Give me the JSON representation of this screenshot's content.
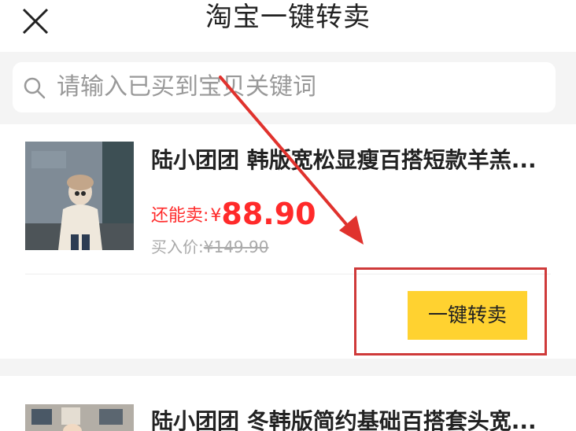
{
  "header": {
    "title": "淘宝一键转卖",
    "close_icon": "close-icon"
  },
  "search": {
    "placeholder": "请输入已买到宝贝关键词",
    "icon": "search-icon"
  },
  "items": [
    {
      "title": "陆小团团 韩版宽松显瘦百搭短款羊羔...",
      "price_label": "还能卖:",
      "price_symbol": "¥",
      "price_value": "88.90",
      "buy_label": "买入价:",
      "buy_value": "¥149.90",
      "button_label": "一键转卖"
    },
    {
      "title": "陆小团团 冬韩版简约基础百搭套头宽..."
    }
  ],
  "colors": {
    "accent_yellow": "#ffd230",
    "price_red": "#ff2a2a",
    "annotation_red": "#cf3a3a",
    "background_gray": "#f4f4f4"
  }
}
